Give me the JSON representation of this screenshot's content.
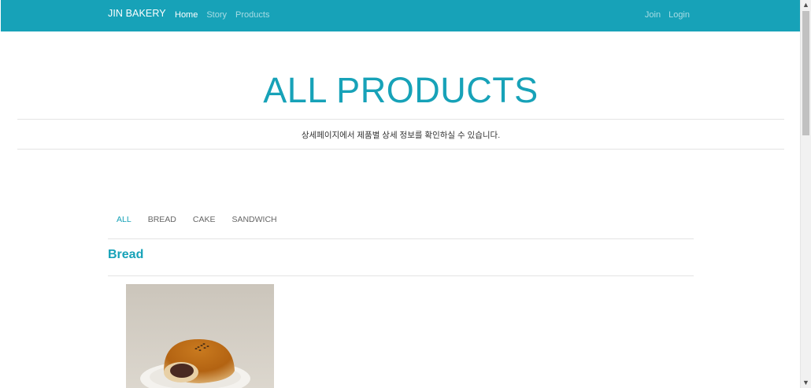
{
  "navbar": {
    "brand": "JIN BAKERY",
    "links": [
      {
        "label": "Home",
        "active": true
      },
      {
        "label": "Story",
        "active": false
      },
      {
        "label": "Products",
        "active": false
      }
    ],
    "right_links": [
      {
        "label": "Join"
      },
      {
        "label": "Login"
      }
    ],
    "color": "#17a2b8"
  },
  "hero": {
    "title": "ALL PRODUCTS",
    "subtitle": "상세페이지에서 제품별 상세 정보를 확인하실 수 있습니다."
  },
  "categories": [
    {
      "label": "ALL",
      "active": true
    },
    {
      "label": "BREAD",
      "active": false
    },
    {
      "label": "CAKE",
      "active": false
    },
    {
      "label": "SANDWICH",
      "active": false
    }
  ],
  "section": {
    "title": "Bread"
  },
  "product": {
    "image": "red-bean-bread-photo"
  },
  "scrollbar": {
    "up_icon": "chevron-up-icon",
    "down_icon": "chevron-down-icon"
  }
}
